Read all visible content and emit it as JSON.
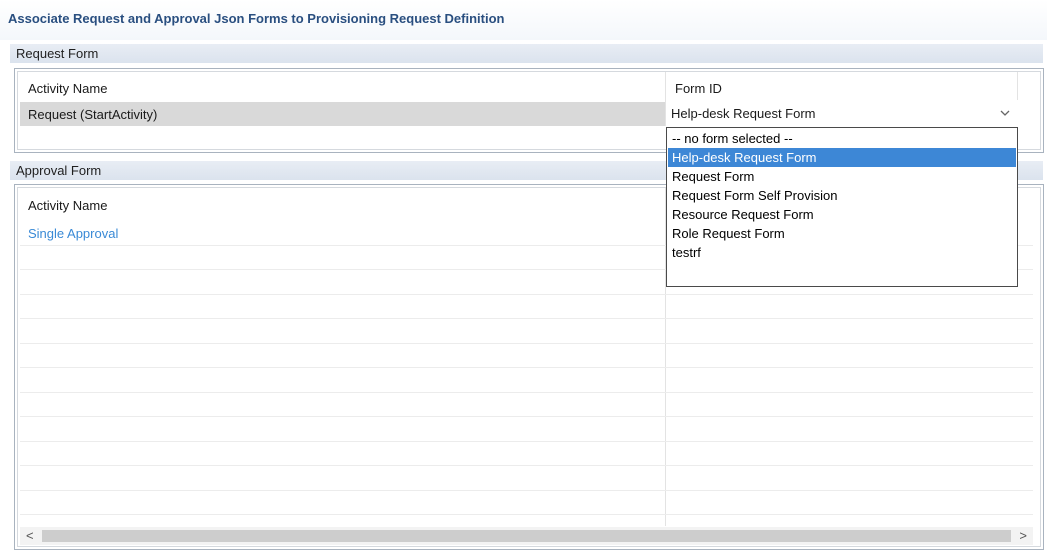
{
  "title": "Associate Request and Approval Json Forms to Provisioning Request Definition",
  "request_section": {
    "header": "Request Form",
    "col_activity": "Activity Name",
    "col_form": "Form ID",
    "row_activity": "Request (StartActivity)",
    "row_form_value": "Help-desk Request Form"
  },
  "dropdown": {
    "options": [
      "-- no form selected --",
      "Help-desk Request Form",
      "Request Form",
      "Request Form Self Provision",
      "Resource Request Form",
      "Role Request Form",
      "testrf"
    ],
    "selected_index": 1
  },
  "approval_section": {
    "header": "Approval Form",
    "col_activity": "Activity Name",
    "row_activity": "Single Approval"
  },
  "scrollbar": {
    "left_arrow": "<",
    "right_arrow": ">"
  },
  "colors": {
    "title": "#2a4f80",
    "selection": "#3d87d6",
    "link": "#3a8ad6"
  },
  "icons": {
    "combo_arrow": "chevron-down-icon"
  }
}
